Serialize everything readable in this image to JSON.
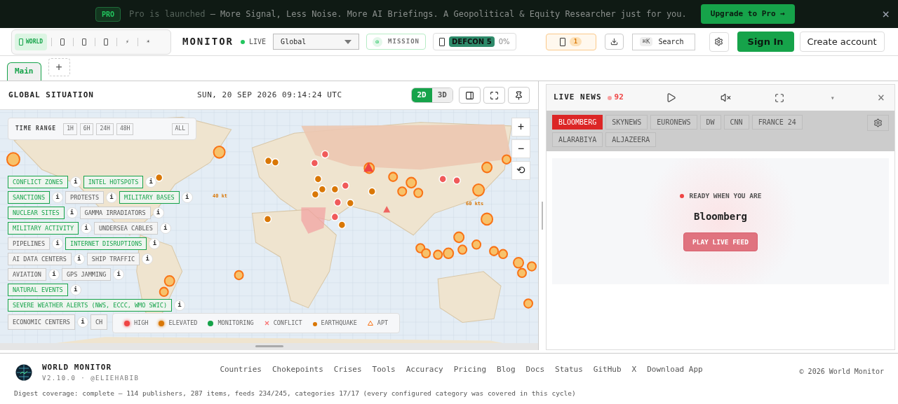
{
  "banner": {
    "badge": "PRO",
    "lead": "Pro is launched",
    "text": "— More Signal, Less Noise. More AI Briefings. A Geopolitical & Equity Researcher just for you.",
    "cta": "Upgrade to Pro →",
    "close": "×"
  },
  "header": {
    "variants": [
      {
        "kind": "label",
        "label": "WORLD",
        "selected": true
      },
      {
        "kind": "box",
        "selected": false
      },
      {
        "kind": "box",
        "selected": false
      },
      {
        "kind": "box",
        "selected": false
      },
      {
        "kind": "char",
        "label": "⚡",
        "selected": false
      },
      {
        "kind": "char",
        "label": "☀",
        "selected": false
      }
    ],
    "brand": "MONITOR",
    "live": "LIVE",
    "region": "Global",
    "mission_icon": "◎",
    "mission": "MISSION",
    "defcon": "DEFCON 5",
    "defcon_pct": "0%",
    "alerts": "1",
    "search_key": "⌘K",
    "search": "Search",
    "sign_in": "Sign In",
    "create": "Create account"
  },
  "tabs": [
    {
      "label": "Main",
      "selected": true
    }
  ],
  "add_tab": "+",
  "map": {
    "title": "GLOBAL SITUATION",
    "datetime": "SUN, 20 SEP 2026 09:14:24 UTC",
    "modes": [
      {
        "label": "2D",
        "selected": true
      },
      {
        "label": "3D",
        "selected": false
      }
    ],
    "time_range": {
      "label": "TIME RANGE",
      "options": [
        {
          "label": "1H",
          "selected": false
        },
        {
          "label": "6H",
          "selected": false
        },
        {
          "label": "24H",
          "selected": false
        },
        {
          "label": "48H",
          "selected": false
        },
        {
          "label": "ALL",
          "selected": false
        }
      ]
    },
    "zoom": [
      "+",
      "−",
      "⟲"
    ],
    "storm_labels": [
      "40 kt",
      "60 kts"
    ],
    "layer_rows": [
      [
        {
          "label": "CONFLICT ZONES",
          "on": true,
          "info": "i"
        },
        {
          "label": "INTEL HOTSPOTS",
          "on": true,
          "info": "i"
        }
      ],
      [
        {
          "label": "SANCTIONS",
          "on": true,
          "info": "i"
        },
        {
          "label": "PROTESTS",
          "on": false,
          "info": "i"
        },
        {
          "label": "MILITARY BASES",
          "on": true,
          "info": "i"
        }
      ],
      [
        {
          "label": "NUCLEAR SITES",
          "on": true,
          "info": "i"
        },
        {
          "label": "GAMMA IRRADIATORS",
          "on": false,
          "info": "i"
        }
      ],
      [
        {
          "label": "MILITARY ACTIVITY",
          "on": true,
          "info": "i"
        },
        {
          "label": "UNDERSEA CABLES",
          "on": false,
          "info": "i"
        }
      ],
      [
        {
          "label": "PIPELINES",
          "on": false,
          "info": "i"
        },
        {
          "label": "INTERNET DISRUPTIONS",
          "on": true,
          "info": "i"
        }
      ],
      [
        {
          "label": "AI DATA CENTERS",
          "on": false,
          "info": "i"
        },
        {
          "label": "SHIP TRAFFIC",
          "on": false,
          "info": "i"
        }
      ],
      [
        {
          "label": "AVIATION",
          "on": false,
          "info": "i"
        },
        {
          "label": "GPS JAMMING",
          "on": false,
          "info": "i"
        }
      ],
      [
        {
          "label": "NATURAL EVENTS",
          "on": true,
          "info": "i"
        }
      ],
      [
        {
          "label": "SEVERE WEATHER ALERTS (NWS, ECCC, WMO SWIC)",
          "on": true,
          "info": "i"
        }
      ],
      [
        {
          "label": "ECONOMIC CENTERS",
          "on": false,
          "info": "i"
        },
        {
          "label": "CH",
          "on": false
        }
      ]
    ],
    "legend": [
      {
        "kind": "glow",
        "label": "HIGH",
        "color": "#ef4444"
      },
      {
        "kind": "glow",
        "label": "ELEVATED",
        "color": "#d97706"
      },
      {
        "kind": "dot",
        "label": "MONITORING",
        "color": "#16a34a"
      },
      {
        "kind": "cross",
        "label": "CONFLICT",
        "color": "#f87171"
      },
      {
        "kind": "small",
        "label": "EARTHQUAKE",
        "color": "#d97706"
      },
      {
        "kind": "triangle",
        "label": "APT",
        "color": "#f97316"
      }
    ]
  },
  "news": {
    "title": "LIVE NEWS",
    "count": "92",
    "menu": "▾",
    "close": "×",
    "channels": [
      {
        "label": "BLOOMBERG",
        "selected": true
      },
      {
        "label": "SKYNEWS",
        "selected": false
      },
      {
        "label": "EURONEWS",
        "selected": false
      },
      {
        "label": "DW",
        "selected": false
      },
      {
        "label": "CNN",
        "selected": false
      },
      {
        "label": "FRANCE 24",
        "selected": false
      },
      {
        "label": "ALARABIYA",
        "selected": false
      },
      {
        "label": "ALJAZEERA",
        "selected": false
      }
    ],
    "status": "READY WHEN YOU ARE",
    "channel_name": "Bloomberg",
    "play": "PLAY LIVE FEED"
  },
  "footer": {
    "name": "WORLD MONITOR",
    "version": "V2.10.0 · @ELIEHABIB",
    "links": [
      "Countries",
      "Chokepoints",
      "Crises",
      "Tools",
      "Accuracy",
      "Pricing",
      "Blog",
      "Docs",
      "Status",
      "GitHub",
      "X",
      "Download App"
    ],
    "copyright": "© 2026 World Monitor",
    "digest": "Digest coverage: complete — 114 publishers, 287 items, feeds 234/245, categories 17/17 (every configured category was covered in this cycle)"
  }
}
